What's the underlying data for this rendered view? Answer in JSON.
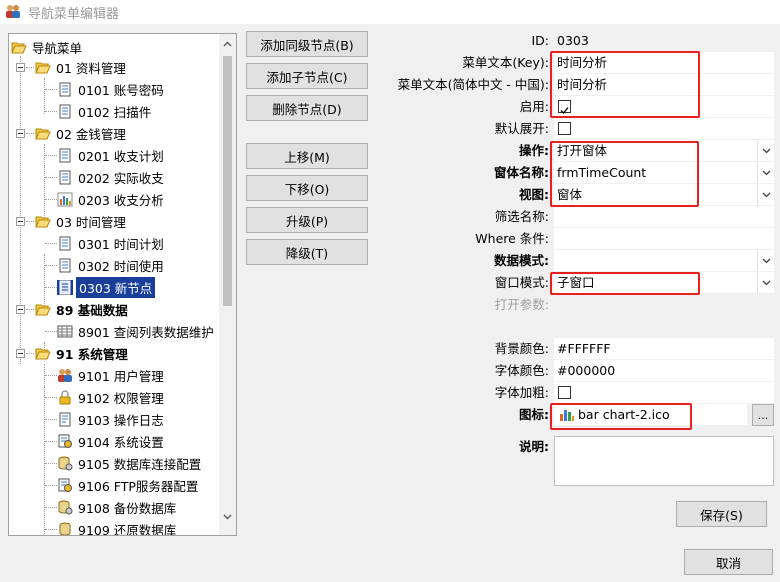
{
  "window": {
    "title": "导航菜单编辑器"
  },
  "tree": {
    "root": "导航菜单",
    "groups": [
      {
        "label": "01 资料管理",
        "children": [
          "0101 账号密码",
          "0102 扫描件"
        ]
      },
      {
        "label": "02 金钱管理",
        "children": [
          "0201 收支计划",
          "0202 实际收支",
          "0203 收支分析"
        ]
      },
      {
        "label": "03 时间管理",
        "children": [
          "0301 时间计划",
          "0302 时间使用",
          "0303 新节点"
        ]
      },
      {
        "label": "89 基础数据",
        "children": [
          "8901 查阅列表数据维护"
        ]
      },
      {
        "label": "91 系统管理",
        "children": [
          "9101 用户管理",
          "9102 权限管理",
          "9103 操作日志",
          "9104 系统设置",
          "9105 数据库连接配置",
          "9106 FTP服务器配置",
          "9108 备份数据库",
          "9109 还原数据库"
        ]
      }
    ],
    "selected": "0303 新节点"
  },
  "buttons": {
    "add_sibling": "添加同级节点(B)",
    "add_child": "添加子节点(C)",
    "delete_node": "删除节点(D)",
    "move_up": "上移(M)",
    "move_down": "下移(O)",
    "promote": "升级(P)",
    "demote": "降级(T)",
    "save": "保存(S)",
    "cancel": "取消"
  },
  "properties": {
    "id": {
      "label": "ID:",
      "value": "0303"
    },
    "menu_text_key": {
      "label": "菜单文本(Key):",
      "value": "时间分析"
    },
    "menu_text_zh": {
      "label": "菜单文本(简体中文 - 中国):",
      "value": "时间分析"
    },
    "enabled": {
      "label": "启用:",
      "checked": true
    },
    "default_expand": {
      "label": "默认展开:",
      "checked": false
    },
    "operation": {
      "label": "操作:",
      "value": "打开窗体"
    },
    "form_name": {
      "label": "窗体名称:",
      "value": "frmTimeCount"
    },
    "view": {
      "label": "视图:",
      "value": "窗体"
    },
    "filter_name": {
      "label": "筛选名称:",
      "value": ""
    },
    "where_clause": {
      "label": "Where 条件:",
      "value": ""
    },
    "data_mode": {
      "label": "数据模式:",
      "value": ""
    },
    "window_mode": {
      "label": "窗口模式:",
      "value": "子窗口"
    },
    "open_params": {
      "label": "打开参数:",
      "value": ""
    },
    "bg_color": {
      "label": "背景颜色:",
      "value": "#FFFFFF"
    },
    "font_color": {
      "label": "字体颜色:",
      "value": "#000000"
    },
    "font_bold": {
      "label": "字体加粗:",
      "checked": false
    },
    "icon": {
      "label": "图标:",
      "value": "bar chart-2.ico",
      "browse": "..."
    },
    "description": {
      "label": "说明:",
      "value": ""
    }
  },
  "colors": {
    "highlight": "#e8201e",
    "selection": "#1a3f9a"
  }
}
